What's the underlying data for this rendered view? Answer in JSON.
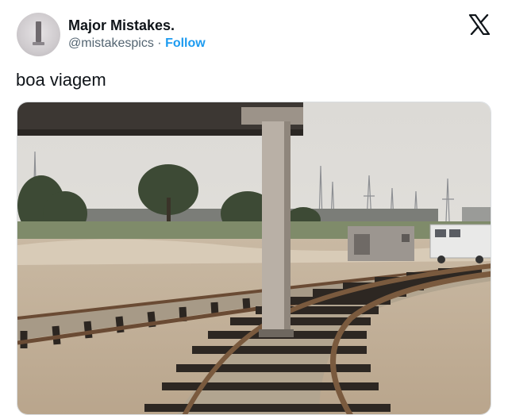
{
  "author": {
    "display_name": "Major Mistakes.",
    "handle": "@mistakespics",
    "separator": "·",
    "follow_label": "Follow"
  },
  "tweet": {
    "text": "boa viagem"
  },
  "icons": {
    "platform_logo": "x-logo-icon"
  },
  "colors": {
    "follow": "#1d9bf0",
    "text": "#0f1419",
    "secondary_text": "#536471"
  }
}
